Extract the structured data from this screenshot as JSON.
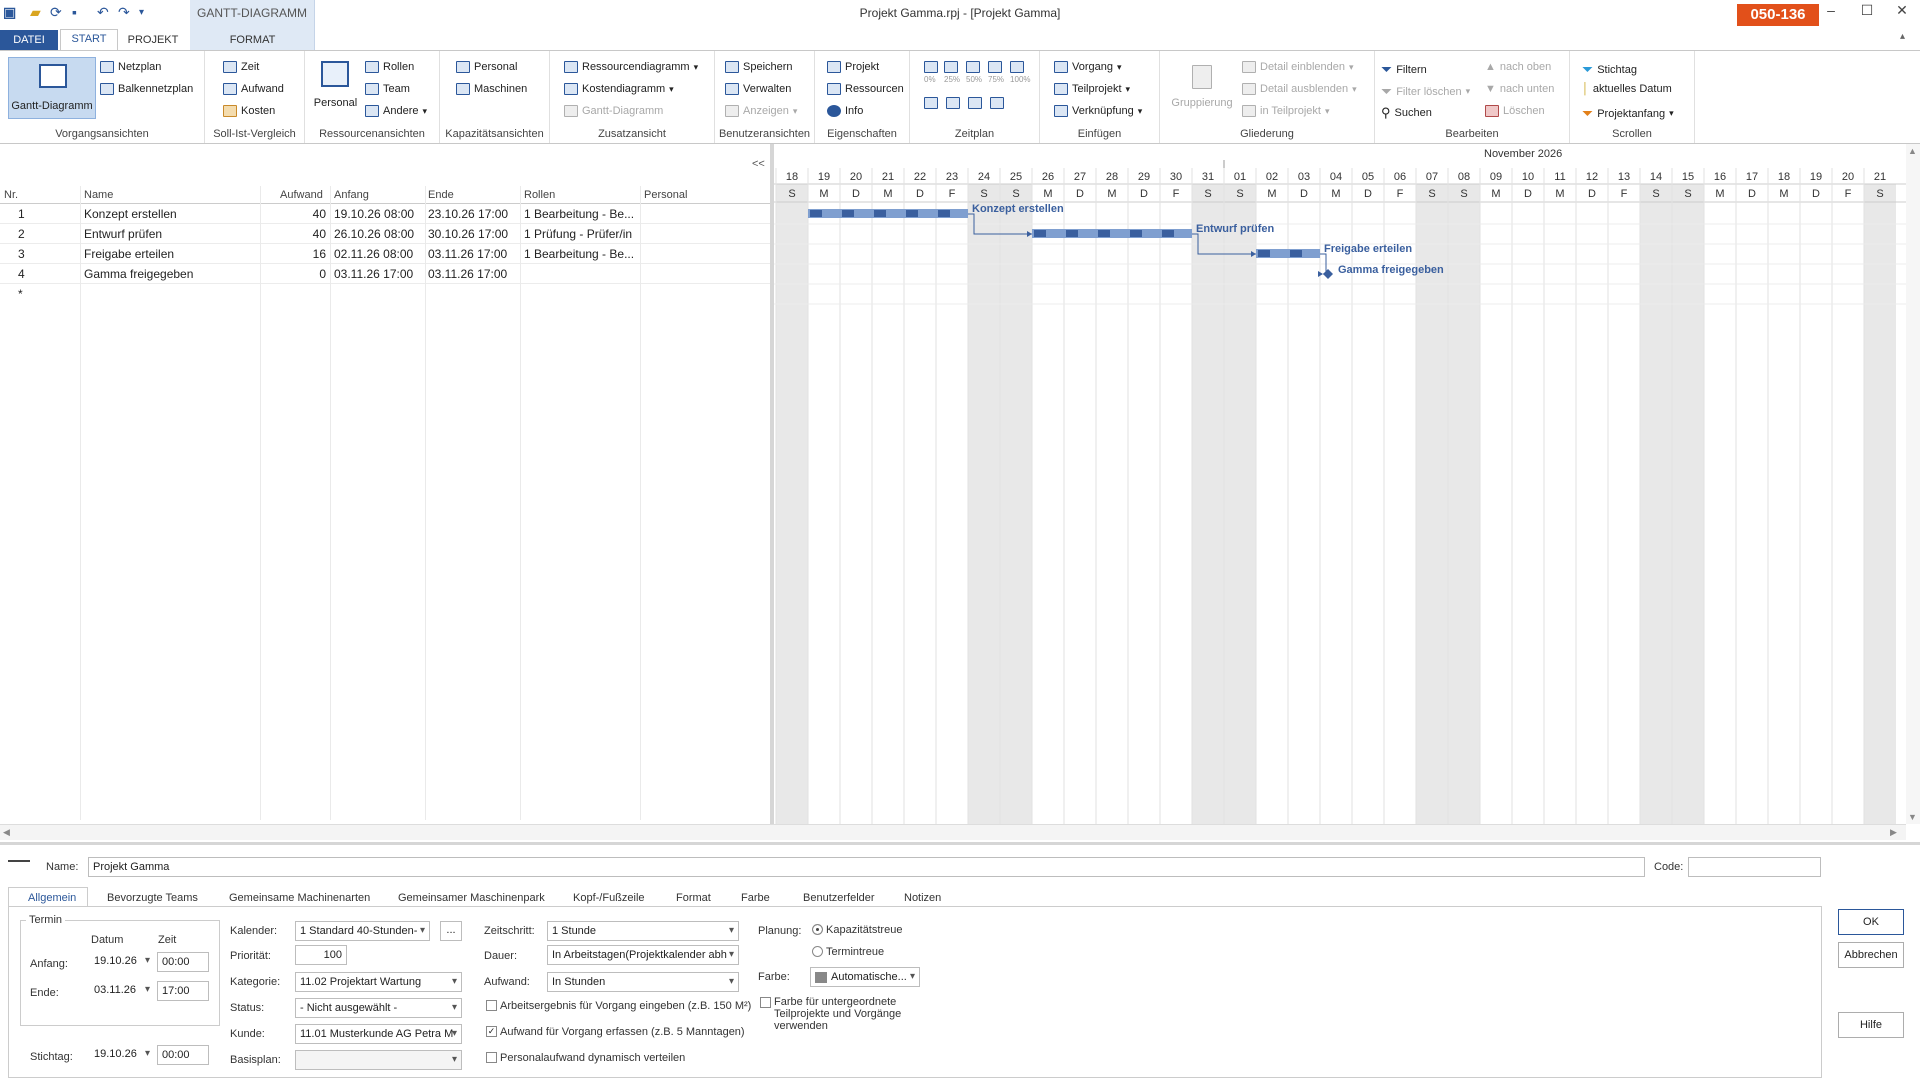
{
  "title": "Projekt Gamma.rpj - [Projekt Gamma]",
  "badge": "050-136",
  "context_group": "GANTT-DIAGRAMM",
  "tabs": {
    "datei": "DATEI",
    "start": "START",
    "projekt": "PROJEKT",
    "format": "FORMAT"
  },
  "ribbon": {
    "vorgangsansichten": {
      "label": "Vorgangsansichten",
      "gantt": "Gantt-Diagramm",
      "netzplan": "Netzplan",
      "balkennetzplan": "Balkennetzplan"
    },
    "soll_ist": {
      "label": "Soll-Ist-Vergleich",
      "zeit": "Zeit",
      "aufwand": "Aufwand",
      "kosten": "Kosten"
    },
    "ressourcenansichten": {
      "label": "Ressourcenansichten",
      "personal": "Personal",
      "rollen": "Rollen",
      "team": "Team",
      "andere": "Andere"
    },
    "kapazitaet": {
      "label": "Kapazitätsansichten",
      "personal": "Personal",
      "maschinen": "Maschinen"
    },
    "zusatz": {
      "label": "Zusatzansicht",
      "ressourcendiagramm": "Ressourcendiagramm",
      "kostendiagramm": "Kostendiagramm",
      "gantt": "Gantt-Diagramm"
    },
    "benutzer": {
      "label": "Benutzeransichten",
      "speichern": "Speichern",
      "verwalten": "Verwalten",
      "anzeigen": "Anzeigen"
    },
    "eigenschaften": {
      "label": "Eigenschaften",
      "projekt": "Projekt",
      "ressourcen": "Ressourcen",
      "info": "Info"
    },
    "zeitplan": {
      "label": "Zeitplan",
      "p0": "0%",
      "p25": "25%",
      "p50": "50%",
      "p75": "75%",
      "p100": "100%"
    },
    "einfuegen": {
      "label": "Einfügen",
      "vorgang": "Vorgang",
      "teilprojekt": "Teilprojekt",
      "verknuepfung": "Verknüpfung"
    },
    "gliederung": {
      "label": "Gliederung",
      "gruppierung": "Gruppierung",
      "detail_ein": "Detail einblenden",
      "detail_aus": "Detail ausblenden",
      "in_teilprojekt": "in Teilprojekt"
    },
    "bearbeiten": {
      "label": "Bearbeiten",
      "filtern": "Filtern",
      "filter_loeschen": "Filter löschen",
      "suchen": "Suchen",
      "nach_oben": "nach oben",
      "nach_unten": "nach unten",
      "loeschen": "Löschen"
    },
    "scrollen": {
      "label": "Scrollen",
      "stichtag": "Stichtag",
      "aktuelles_datum": "aktuelles Datum",
      "projektanfang": "Projektanfang"
    }
  },
  "grid": {
    "collapse": "<<",
    "headers": {
      "nr": "Nr.",
      "name": "Name",
      "aufwand": "Aufwand",
      "anfang": "Anfang",
      "ende": "Ende",
      "rollen": "Rollen",
      "personal": "Personal"
    },
    "rows": [
      {
        "nr": "1",
        "name": "Konzept erstellen",
        "aufwand": "40",
        "anfang": "19.10.26 08:00",
        "ende": "23.10.26 17:00",
        "rollen": "1 Bearbeitung - Be..."
      },
      {
        "nr": "2",
        "name": "Entwurf prüfen",
        "aufwand": "40",
        "anfang": "26.10.26 08:00",
        "ende": "30.10.26 17:00",
        "rollen": "1 Prüfung - Prüfer/in"
      },
      {
        "nr": "3",
        "name": "Freigabe erteilen",
        "aufwand": "16",
        "anfang": "02.11.26 08:00",
        "ende": "03.11.26 17:00",
        "rollen": "1 Bearbeitung - Be..."
      },
      {
        "nr": "4",
        "name": "Gamma freigegeben",
        "aufwand": "0",
        "anfang": "03.11.26 17:00",
        "ende": "03.11.26 17:00",
        "rollen": ""
      }
    ],
    "new_row": "*"
  },
  "timeline": {
    "month": "November 2026",
    "days": [
      "18",
      "19",
      "20",
      "21",
      "22",
      "23",
      "24",
      "25",
      "26",
      "27",
      "28",
      "29",
      "30",
      "31",
      "01",
      "02",
      "03",
      "04",
      "05",
      "06",
      "07",
      "08",
      "09",
      "10",
      "11",
      "12",
      "13",
      "14",
      "15",
      "16",
      "17",
      "18",
      "19",
      "20",
      "21"
    ],
    "weekdays": [
      "S",
      "M",
      "D",
      "M",
      "D",
      "F",
      "S",
      "S",
      "M",
      "D",
      "M",
      "D",
      "F",
      "S",
      "S",
      "M",
      "D",
      "M",
      "D",
      "F",
      "S",
      "S",
      "M",
      "D",
      "M",
      "D",
      "F",
      "S",
      "S",
      "M",
      "D",
      "M",
      "D",
      "F",
      "S"
    ],
    "weekend_index": [
      0,
      6,
      7,
      13,
      14,
      20,
      21,
      27,
      28,
      34
    ],
    "bars": [
      {
        "label": "Konzept erstellen",
        "start": 1,
        "end": 6
      },
      {
        "label": "Entwurf prüfen",
        "start": 8,
        "end": 13
      },
      {
        "label": "Freigabe erteilen",
        "start": 15,
        "end": 17
      },
      {
        "label": "Gamma freigegeben",
        "milestone": 17
      }
    ]
  },
  "form": {
    "name_label": "Name:",
    "name_value": "Projekt Gamma",
    "code_label": "Code:",
    "code_value": "",
    "tabs": [
      "Allgemein",
      "Bevorzugte Teams",
      "Gemeinsame Machinenarten",
      "Gemeinsamer Maschinenpark",
      "Kopf-/Fußzeile",
      "Format",
      "Farbe",
      "Benutzerfelder",
      "Notizen"
    ],
    "termin": "Termin",
    "datum": "Datum",
    "zeit": "Zeit",
    "anfang_label": "Anfang:",
    "anfang_datum": "19.10.26",
    "anfang_zeit": "00:00",
    "ende_label": "Ende:",
    "ende_datum": "03.11.26",
    "ende_zeit": "17:00",
    "stichtag_label": "Stichtag:",
    "stichtag_datum": "19.10.26",
    "stichtag_zeit": "00:00",
    "kalender_label": "Kalender:",
    "kalender": "1 Standard 40-Stunden-",
    "kalender_more": "...",
    "prioritaet_label": "Priorität:",
    "prioritaet": "100",
    "kategorie_label": "Kategorie:",
    "kategorie": "11.02 Projektart Wartung",
    "status_label": "Status:",
    "status": "- Nicht ausgewählt -",
    "kunde_label": "Kunde:",
    "kunde": "11.01 Musterkunde AG Petra M",
    "basisplan_label": "Basisplan:",
    "basisplan": "",
    "zeitschritt_label": "Zeitschritt:",
    "zeitschritt": "1 Stunde",
    "dauer_label": "Dauer:",
    "dauer": "In Arbeitstagen(Projektkalender abh",
    "aufwand_label": "Aufwand:",
    "aufwand": "In Stunden",
    "chk_arbeitsergebnis": "Arbeitsergebnis für Vorgang eingeben (z.B. 150 M²)",
    "chk_aufwand": "Aufwand für Vorgang erfassen (z.B. 5 Manntagen)",
    "chk_personal": "Personalaufwand dynamisch verteilen",
    "planung_label": "Planung:",
    "radio_kapazitaet": "Kapazitätstreue",
    "radio_termin": "Termintreue",
    "farbe_label": "Farbe:",
    "farbe": "Automatische...",
    "chk_farbe": "Farbe für untergeordnete Teilprojekte und Vorgänge verwenden",
    "ok": "OK",
    "abbrechen": "Abbrechen",
    "hilfe": "Hilfe"
  },
  "colors": {
    "accent": "#2b579a",
    "bar": "#3a5f9e",
    "bar_light": "#7f9fd0",
    "weekend": "#e8e8e8",
    "badge": "#e2501a"
  }
}
